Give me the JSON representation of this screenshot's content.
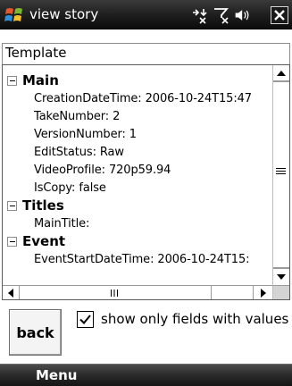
{
  "window": {
    "title": "view story",
    "close_label": "×"
  },
  "status_icons": [
    "start-logo-icon",
    "connectivity-icon",
    "signal-icon",
    "volume-icon",
    "close-icon"
  ],
  "group": {
    "label": "Template"
  },
  "tree": {
    "sections": [
      {
        "name": "Main",
        "expanded": true,
        "fields": [
          "CreationDateTime: 2006-10-24T15:47",
          "TakeNumber: 2",
          "VersionNumber: 1",
          "EditStatus: Raw",
          "VideoProfile: 720p59.94",
          "IsCopy: false"
        ]
      },
      {
        "name": "Titles",
        "expanded": true,
        "fields": [
          "MainTitle:"
        ]
      },
      {
        "name": "Event",
        "expanded": true,
        "fields": [
          "EventStartDateTime: 2006-10-24T15:"
        ]
      }
    ]
  },
  "controls": {
    "back_label": "back",
    "only_values_checked": true,
    "only_values_label": "show only fields with values"
  },
  "softkeys": {
    "left_label": "Menu"
  },
  "colors": {
    "titlebar": "#1d1d1d",
    "softkey_bar": "#2a2a2a",
    "panel_border": "#5a5a5a"
  }
}
